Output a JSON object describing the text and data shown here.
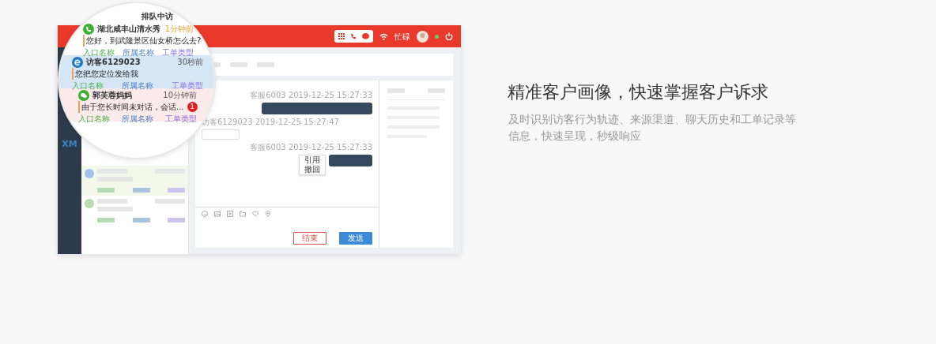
{
  "mockup": {
    "top_bar": {
      "status": "忙碌",
      "online": true
    },
    "sidebar": {
      "logo": "XM"
    },
    "chat": {
      "messages": [
        {
          "kind": "agent",
          "meta": "客服6003 2019-12-25 15:27:33"
        },
        {
          "kind": "visitor",
          "meta": "访客6129023 2019-12-25 15:27:47"
        },
        {
          "kind": "agent",
          "meta": "客服6003 2019-12-25 15:27:33",
          "menu": [
            "引用",
            "撤回"
          ]
        }
      ],
      "buttons": [
        {
          "label": "结束",
          "kind": "outline"
        },
        {
          "label": "发送",
          "kind": "primary"
        }
      ]
    }
  },
  "magnifier": {
    "header": "排队中访",
    "items": [
      {
        "kind": "phone",
        "name": "湖北咸丰山清水秀",
        "time": "1分钟前",
        "message": "您好，到武隆景区仙女桥怎么去?",
        "tags": [
          "入口名称",
          "所属名称",
          "工单类型"
        ],
        "selected": false,
        "unread": false
      },
      {
        "kind": "browser",
        "name": "访客6129023",
        "time": "30秒前",
        "message": "您把您定位发给我",
        "tags": [
          "入口名称",
          "所属名称",
          "工单类型"
        ],
        "selected": true,
        "unread": false
      },
      {
        "kind": "wechat",
        "name": "郭芙蓉妈妈",
        "time": "10分钟前",
        "message": "由于您长时间未对话，会话...",
        "badge": "1",
        "tags": [
          "入口名称",
          "所属名称",
          "工单类型"
        ],
        "selected": false,
        "unread": true
      }
    ]
  },
  "feature": {
    "title": "精准客户画像，快速掌握客户诉求",
    "description": "及时识别访客行为轨迹、来源渠道、聊天历史和工单记录等信息，快速呈现，秒级响应"
  }
}
